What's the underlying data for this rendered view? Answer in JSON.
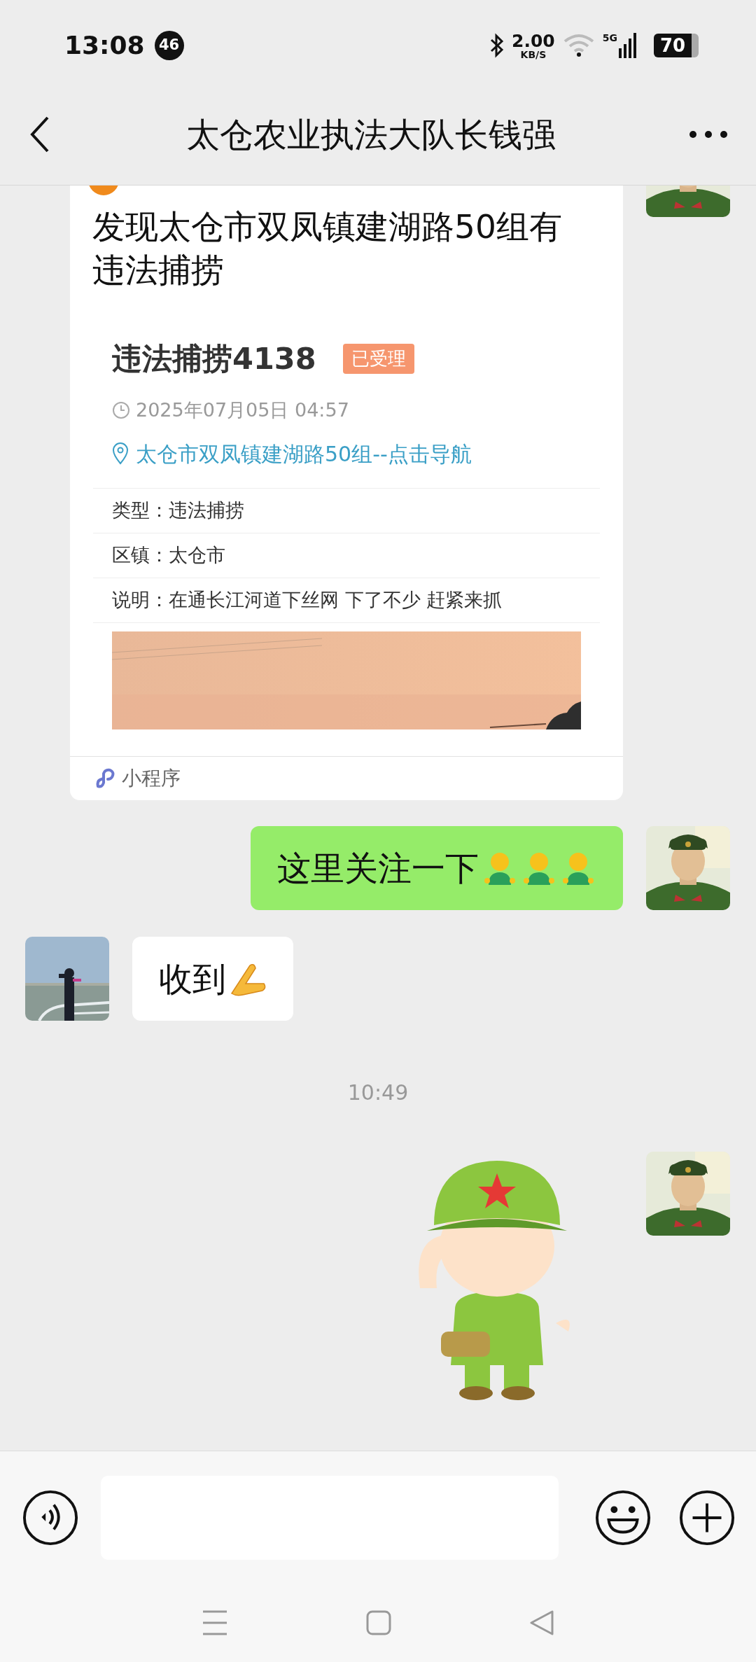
{
  "status_bar": {
    "time": "13:08",
    "notification_count": "46",
    "net_speed": "2.00",
    "net_speed_unit": "KB/S",
    "network_type": "5G",
    "battery": "70"
  },
  "header": {
    "title": "太仓农业执法大队长钱强"
  },
  "messages": [
    {
      "kind": "card",
      "outgoing": true,
      "title": "发现太仓市双凤镇建湖路50组有违法捕捞",
      "case_title": "违法捕捞4138",
      "status": "已受理",
      "time": "2025年07月05日 04:57",
      "location": "太仓市双凤镇建湖路50组--点击导航",
      "fields": [
        {
          "label": "类型：",
          "value": "违法捕捞"
        },
        {
          "label": "区镇：",
          "value": "太仓市"
        },
        {
          "label": "说明：",
          "value": "在通长江河道下丝网 下了不少 赶紧来抓"
        }
      ],
      "source": "小程序"
    },
    {
      "kind": "text",
      "outgoing": true,
      "text": "这里关注一下"
    },
    {
      "kind": "text",
      "outgoing": false,
      "text": "收到"
    },
    {
      "kind": "time",
      "text": "10:49"
    },
    {
      "kind": "sticker",
      "outgoing": true
    }
  ]
}
